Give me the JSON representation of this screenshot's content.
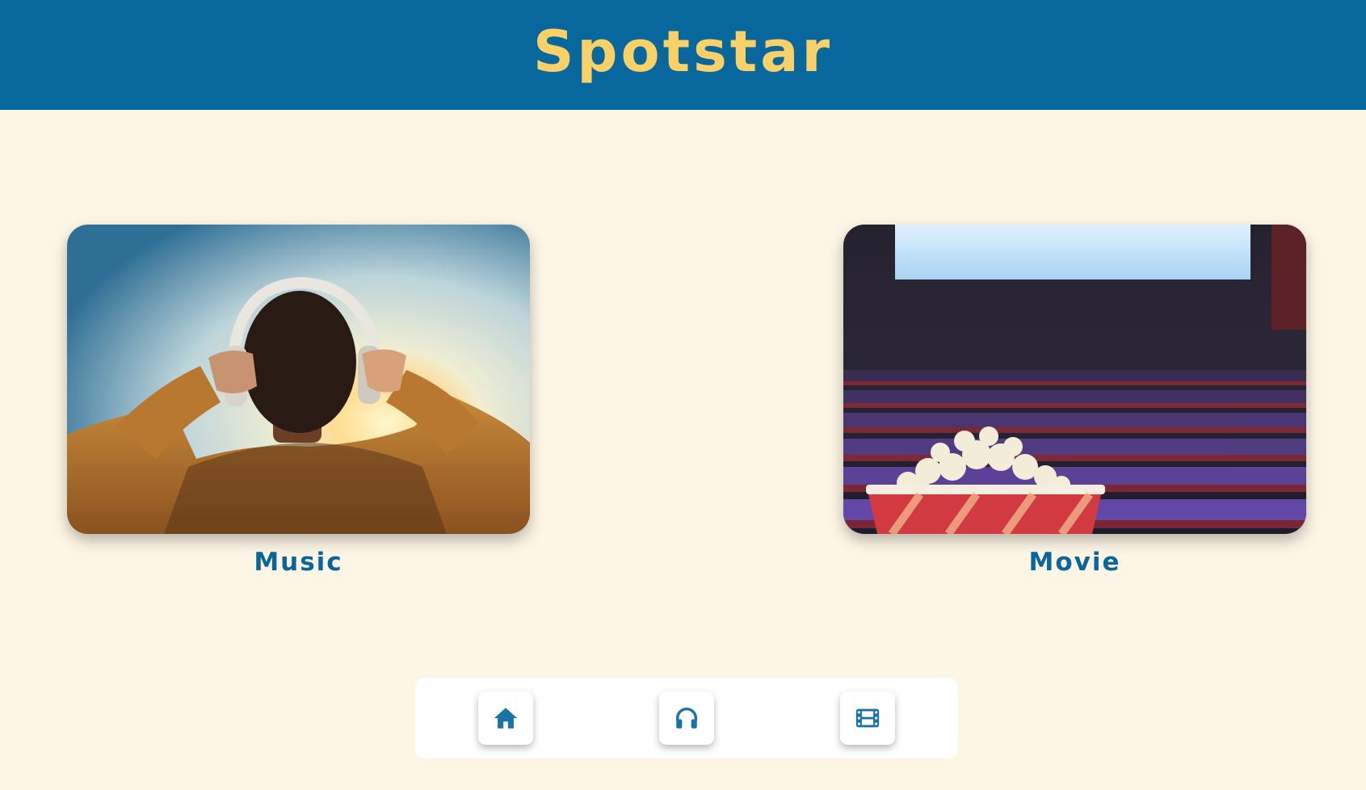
{
  "header": {
    "title": "Spotstar"
  },
  "cards": [
    {
      "label": "Music",
      "image": "person-wearing-headphones-sunset"
    },
    {
      "label": "Movie",
      "image": "popcorn-in-cinema-hall"
    }
  ],
  "nav": {
    "items": [
      {
        "icon": "home-icon"
      },
      {
        "icon": "headphones-icon"
      },
      {
        "icon": "film-icon"
      }
    ]
  },
  "colors": {
    "header_bg": "#08689e",
    "brand_text": "#fad166",
    "page_bg": "#fdf6e5",
    "label_text": "#0a659a",
    "icon": "#1a73a8"
  }
}
